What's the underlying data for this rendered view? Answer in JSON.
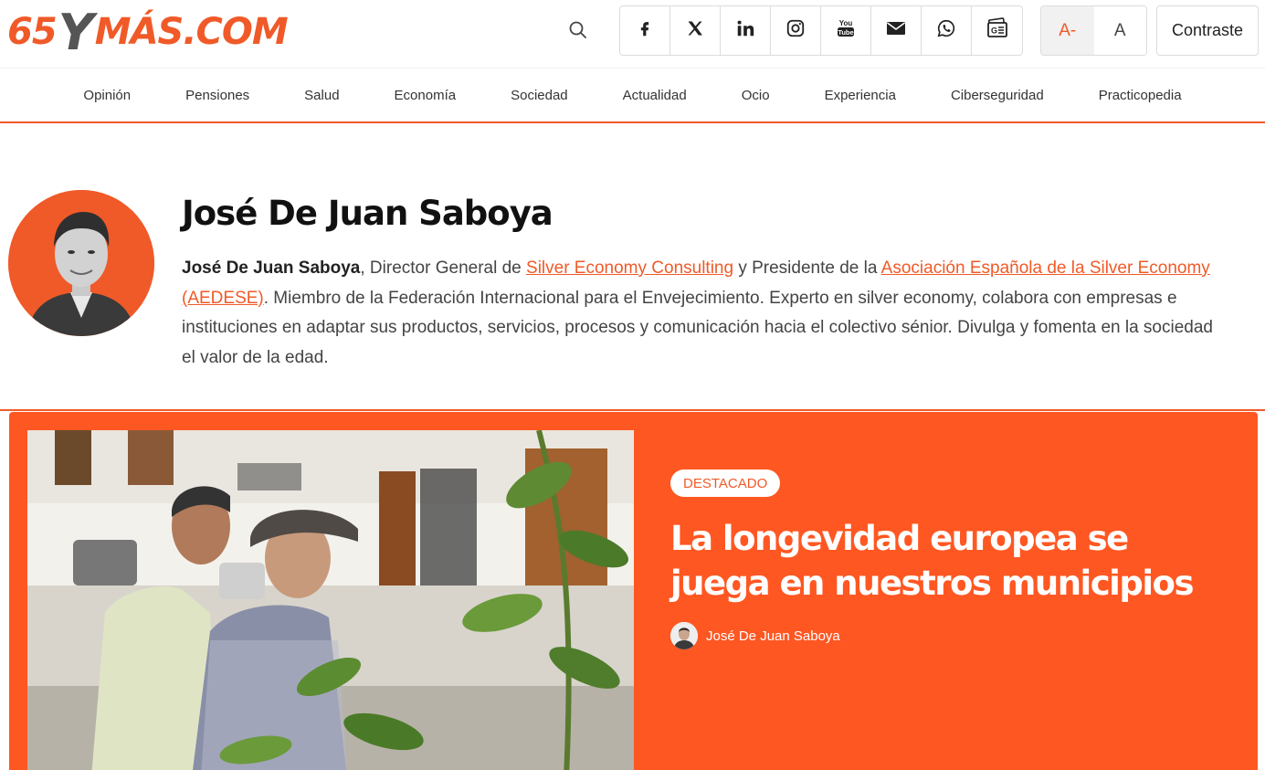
{
  "header": {
    "logo": {
      "part1": "65",
      "part2": "Y",
      "part3": "MÁS.COM"
    },
    "social": [
      {
        "icon": "facebook-icon"
      },
      {
        "icon": "x-twitter-icon"
      },
      {
        "icon": "linkedin-icon"
      },
      {
        "icon": "instagram-icon"
      },
      {
        "icon": "youtube-icon"
      },
      {
        "icon": "email-icon"
      },
      {
        "icon": "whatsapp-icon"
      },
      {
        "icon": "google-news-icon"
      }
    ],
    "font_decrease": "A-",
    "font_normal": "A",
    "contrast": "Contraste"
  },
  "nav": {
    "items": [
      "Opinión",
      "Pensiones",
      "Salud",
      "Economía",
      "Sociedad",
      "Actualidad",
      "Ocio",
      "Experiencia",
      "Ciberseguridad",
      "Practicopedia"
    ]
  },
  "author": {
    "name": "José De Juan Saboya",
    "bio_name": "José De Juan Saboya",
    "bio_1": ", Director General de ",
    "link_1": "Silver Economy Consulting",
    "bio_2": " y Presidente de la ",
    "link_2": "Asociación Española de la Silver Economy (AEDESE)",
    "bio_3": ". Miembro de la Federación Internacional para el Envejecimiento. Experto en silver economy, colabora con empresas e instituciones en adaptar sus productos, servicios, procesos y comunicación hacia el colectivo sénior. Divulga y fomenta en la sociedad el valor de la edad."
  },
  "featured": {
    "badge": "DESTACADO",
    "title": "La longevidad europea se juega en nuestros municipios",
    "author": "José De Juan Saboya"
  },
  "colors": {
    "accent": "#f05a28",
    "card": "#ff5722"
  }
}
